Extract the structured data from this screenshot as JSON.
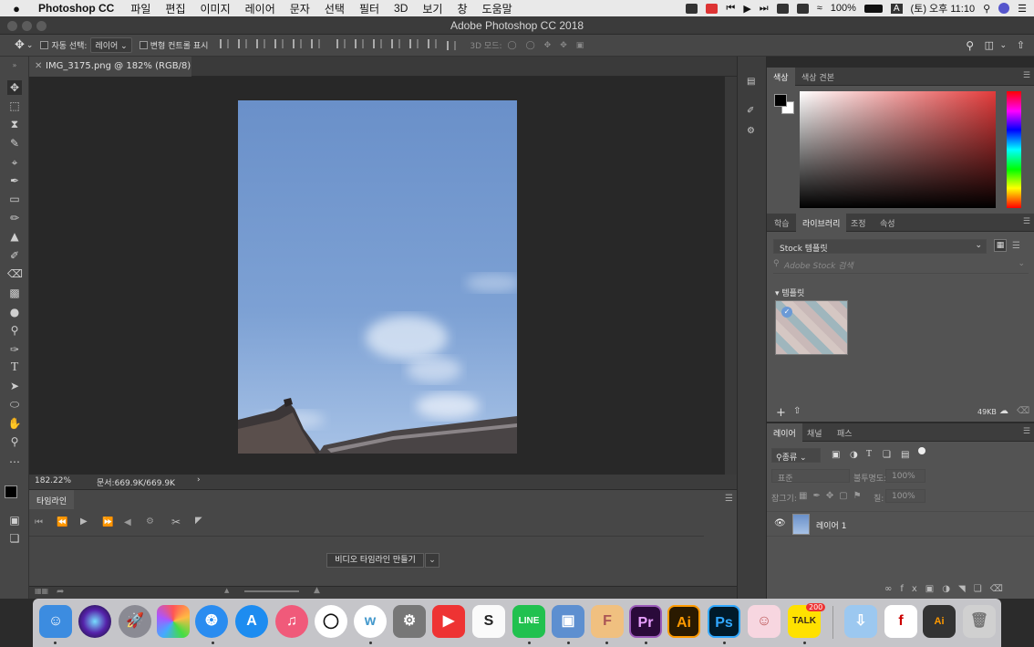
{
  "menubar": {
    "apple": "",
    "app_name": "Photoshop CC",
    "items": [
      "파일",
      "편집",
      "이미지",
      "레이어",
      "문자",
      "선택",
      "필터",
      "3D",
      "보기",
      "창",
      "도움말"
    ],
    "battery": "100%",
    "input_source": "A",
    "clock": "(토) 오후 11:10"
  },
  "window": {
    "title": "Adobe Photoshop CC 2018"
  },
  "options_bar": {
    "auto_select_label": "자동 선택:",
    "auto_select_target": "레이어",
    "transform_controls_label": "변형 컨트롤 표시",
    "mode_3d_label": "3D 모드:"
  },
  "document": {
    "tab_title": "IMG_3175.png @ 182% (RGB/8)",
    "zoom": "182.22%",
    "doc_size": "문서:669.9K/669.9K"
  },
  "timeline": {
    "tab_label": "타임라인",
    "create_button": "비디오 타임라인 만들기"
  },
  "color_panel": {
    "tabs": [
      "색상",
      "색상 견본"
    ],
    "active_tab": "색상",
    "foreground": "#000000",
    "background": "#ffffff"
  },
  "library_panel": {
    "tabs": [
      "학습",
      "라이브러리",
      "조정",
      "속성"
    ],
    "active_tab": "라이브러리",
    "library_select": "Stock 템플릿",
    "search_placeholder": "Adobe Stock 검색",
    "section_label": "템플릿",
    "storage": "49KB"
  },
  "layers_panel": {
    "tabs": [
      "레이어",
      "채널",
      "패스"
    ],
    "active_tab": "레이어",
    "filter_label": "종류",
    "blend_mode": "표준",
    "opacity_label": "불투명도:",
    "opacity_value": "100%",
    "lock_label": "잠그기:",
    "fill_label": "칠:",
    "fill_value": "100%",
    "layers": [
      {
        "name": "레이어 1",
        "visible": true
      }
    ]
  },
  "dock": {
    "apps": [
      "finder",
      "siri",
      "launchpad",
      "photos",
      "safari",
      "app-store",
      "itunes",
      "clock-app",
      "w-app",
      "system-preferences",
      "rec-app",
      "slides-app",
      "line",
      "preview",
      "flash-360",
      "premiere",
      "illustrator",
      "photoshop",
      "character-app",
      "kakaotalk",
      "downloads",
      "flash",
      "ai-file",
      "trash"
    ],
    "kakaotalk_badge": "200"
  },
  "colors": {
    "panel_bg": "#535353",
    "header_bg": "#3d3d3d",
    "canvas_bg": "#282828",
    "sky_top": "#6f93c9",
    "sky_bottom": "#a9c4e6"
  }
}
